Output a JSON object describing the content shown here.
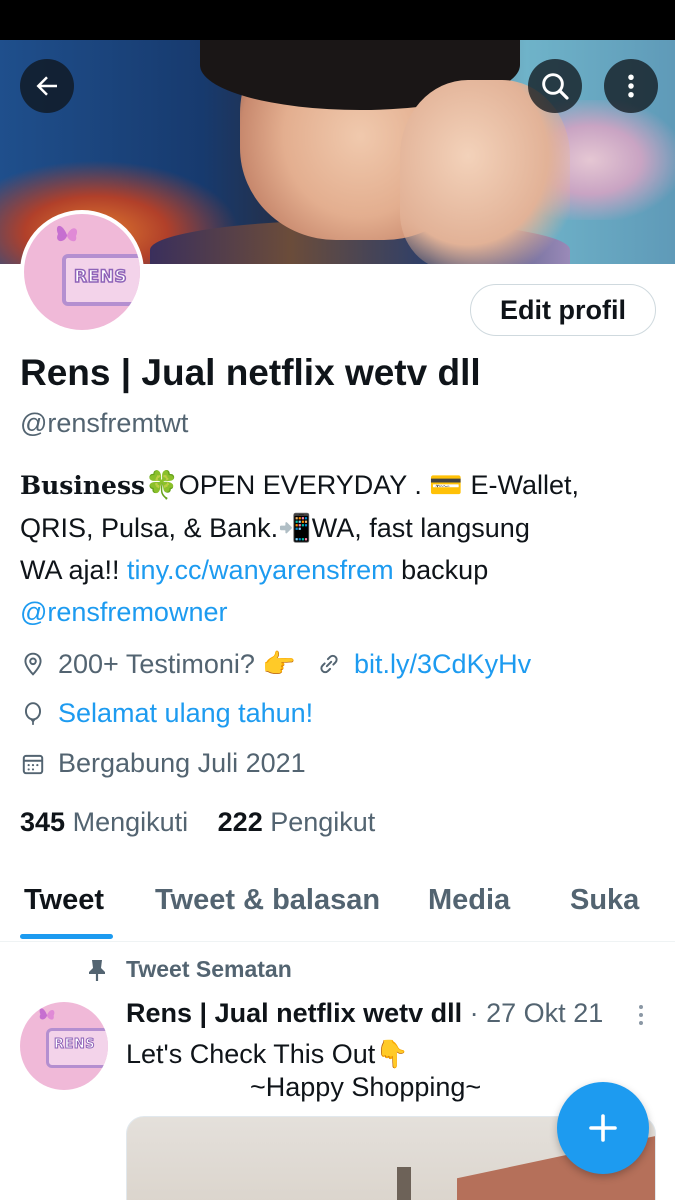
{
  "profile": {
    "display_name": "Rens | Jual netflix wetv dll",
    "handle": "@rensfremtwt",
    "avatar_text": "RENS",
    "edit_button_label": "Edit profil"
  },
  "bio": {
    "prefix_bold": "Business",
    "line1_rest": "🍀OPEN EVERYDAY . 💳 E-Wallet,",
    "line2": "QRIS, Pulsa, & Bank.📲WA, fast langsung",
    "line3_start": "WA aja!! ",
    "line3_link": "tiny.cc/wanyarensfrem",
    "line3_end": "  backup",
    "line4_link": "@rensfremowner"
  },
  "meta": {
    "location_text": "200+ Testimoni? 👉",
    "website_link": "bit.ly/3CdKyHv",
    "birthday_text": "Selamat ulang tahun!",
    "joined_text": "Bergabung Juli 2021"
  },
  "stats": {
    "following_count": "345",
    "following_label": "Mengikuti",
    "followers_count": "222",
    "followers_label": "Pengikut"
  },
  "tabs": [
    {
      "label": "Tweet",
      "active": true
    },
    {
      "label": "Tweet & balasan",
      "active": false
    },
    {
      "label": "Media",
      "active": false
    },
    {
      "label": "Suka",
      "active": false
    }
  ],
  "pinned_tweet": {
    "pinned_label": "Tweet Sematan",
    "author_name": "Rens | Jual netflix wetv dll",
    "date": " · 27 Okt 21",
    "text_line1": "Let's Check This Out👇",
    "text_line2": "~Happy Shopping~"
  },
  "colors": {
    "accent": "#1d9bf0",
    "text_primary": "#0f1419",
    "text_secondary": "#536471"
  },
  "icons": [
    "back-arrow-icon",
    "search-icon",
    "more-vertical-icon",
    "location-icon",
    "link-icon",
    "balloon-icon",
    "calendar-icon",
    "pin-icon",
    "compose-plus-icon"
  ]
}
